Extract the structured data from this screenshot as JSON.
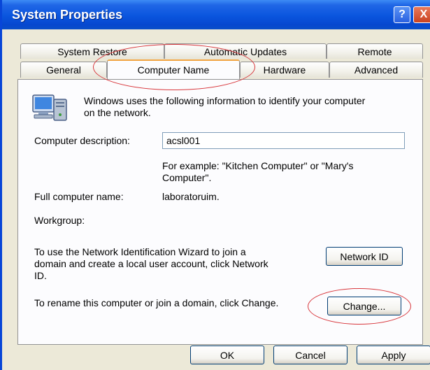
{
  "window": {
    "title": "System Properties",
    "help_glyph": "?",
    "close_glyph": "X"
  },
  "tabs": {
    "row1": [
      {
        "label": "System Restore"
      },
      {
        "label": "Automatic Updates"
      },
      {
        "label": "Remote"
      }
    ],
    "row2": [
      {
        "label": "General"
      },
      {
        "label": "Computer Name",
        "active": true
      },
      {
        "label": "Hardware"
      },
      {
        "label": "Advanced"
      }
    ]
  },
  "panel": {
    "intro_line1": "Windows uses the following information to identify your computer",
    "intro_line2": "on the network.",
    "description_label": "Computer description:",
    "description_value": "acsl001",
    "example_line1": "For example: \"Kitchen Computer\" or \"Mary's",
    "example_line2": "Computer\".",
    "full_name_label": "Full computer name:",
    "full_name_value": "laboratoruim.",
    "workgroup_label": "Workgroup:",
    "wizard_line1": "To use the Network Identification Wizard to join a",
    "wizard_line2": "domain and create a local user account, click Network",
    "wizard_line3": "ID.",
    "network_id_button": "Network ID",
    "rename_text": "To rename this computer or join a domain, click Change.",
    "change_button": "Change..."
  },
  "footer": {
    "ok": "OK",
    "cancel": "Cancel",
    "apply": "Apply"
  },
  "colors": {
    "titlebar": "#0a55de",
    "dialog_bg": "#ece9d8",
    "annotation_red": "#d8373c",
    "active_tab_accent": "#f1a340"
  },
  "icons": {
    "computer": "computer-network-icon"
  }
}
